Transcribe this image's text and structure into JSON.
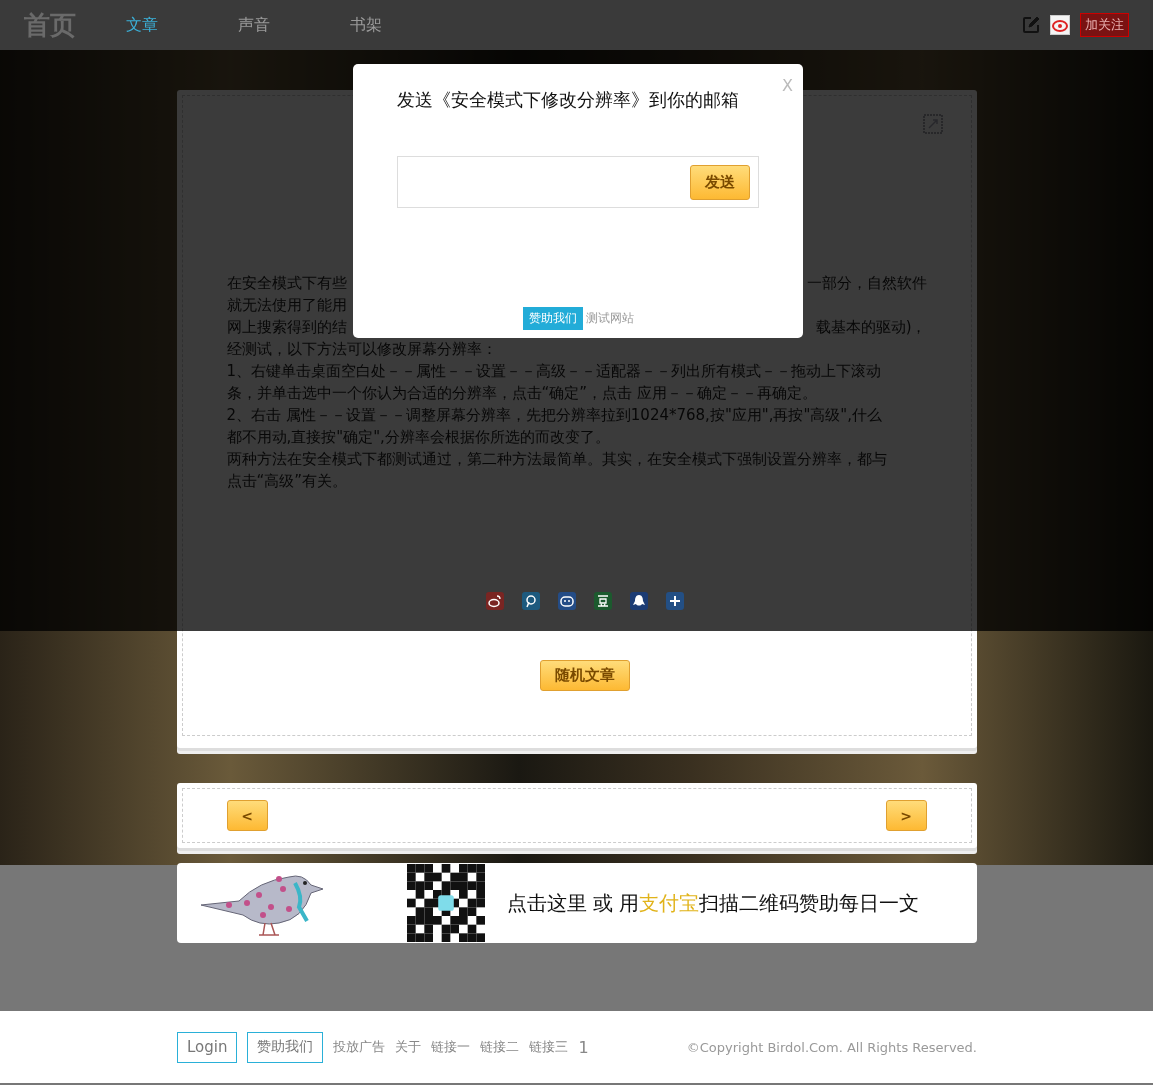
{
  "header": {
    "logo": "首页",
    "tabs": [
      {
        "label": "文章",
        "selected": true
      },
      {
        "label": "声音",
        "selected": false
      },
      {
        "label": "书架",
        "selected": false
      }
    ],
    "follow_badge": "加关注"
  },
  "article": {
    "partial_lines": [
      {
        "left": "在安全模式下有些",
        "right": "一部分，自然软件"
      },
      {
        "left": "就无法使用了能用"
      },
      {
        "left": "网上搜索得到的结",
        "right": "载基本的驱动)，"
      }
    ],
    "paragraphs": [
      "经测试，以下方法可以修改屏幕分辨率：",
      "1、右键单击桌面空白处－－属性－－设置－－高级－－适配器－－列出所有模式－－拖动上下滚动条，并单击选中一个你认为合适的分辨率，点击“确定”，点击 应用－－确定－－再确定。",
      "2、右击 属性－－设置－－调整屏幕分辨率，先把分辨率拉到1024*768,按\"应用\",再按\"高级\",什么都不用动,直接按\"确定\",分辨率会根据你所选的而改变了。",
      "两种方法在安全模式下都测试通过，第二种方法最简单。其实，在安全模式下强制设置分辨率，都与点击“高级”有关。"
    ],
    "share_icons": [
      {
        "kind": "weibo",
        "color": "#7a2522"
      },
      {
        "kind": "p",
        "color": "#1d5a7e"
      },
      {
        "kind": "face",
        "color": "#244c86"
      },
      {
        "kind": "dou",
        "color": "#1c5a2e"
      },
      {
        "kind": "penguin",
        "color": "#1c3c74"
      },
      {
        "kind": "plus",
        "color": "#234f84"
      }
    ],
    "random_button": "随机文章"
  },
  "pager": {
    "prev": "<",
    "next": ">"
  },
  "banner": {
    "before": "点击这里 或 用",
    "highlight": "支付宝",
    "after": "扫描二维码赞助每日一文"
  },
  "modal": {
    "title": "发送《安全模式下修改分辨率》到你的邮箱",
    "close": "X",
    "send_button": "发送",
    "sponsor_badge": "赞助我们",
    "site_link": "测试网站"
  },
  "footer": {
    "buttons": [
      "Login",
      "赞助我们"
    ],
    "links": [
      "投放广告",
      "关于",
      "链接一",
      "链接二",
      "链接三",
      "1"
    ],
    "copyright": "©Copyright Birdol.Com. All Rights Reserved."
  }
}
